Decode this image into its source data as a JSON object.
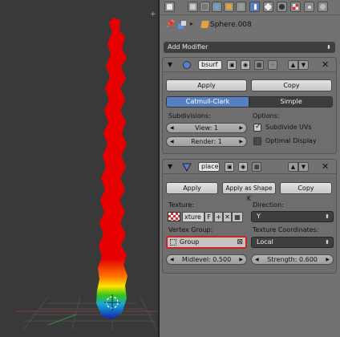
{
  "viewport": {
    "plus": "+"
  },
  "context_tabs": [
    {
      "icon": "render-icon"
    },
    {
      "icon": "render-layers-icon"
    },
    {
      "icon": "scene-icon"
    },
    {
      "icon": "world-icon"
    },
    {
      "icon": "object-icon"
    },
    {
      "icon": "constraints-icon"
    },
    {
      "icon": "modifiers-wrench-icon",
      "active": true
    },
    {
      "icon": "data-icon"
    },
    {
      "icon": "material-icon"
    },
    {
      "icon": "texture-icon"
    },
    {
      "icon": "particles-icon"
    },
    {
      "icon": "physics-icon"
    }
  ],
  "breadcrumb": {
    "object_name": "Sphere.008"
  },
  "add_modifier": "Add Modifier",
  "mod1": {
    "name": "bsurf",
    "apply": "Apply",
    "copy": "Copy",
    "seg_on": "Catmull-Clark",
    "seg_off": "Simple",
    "subdivisions_label": "Subdivisions:",
    "options_label": "Options:",
    "view": "View: 1",
    "render": "Render: 1",
    "subdivide_uvs": "Subdivide UVs",
    "optimal_display": "Optimal Display",
    "subdivide_uvs_checked": true,
    "optimal_display_checked": false
  },
  "mod2": {
    "name": "place",
    "apply": "Apply",
    "apply_shape": "Apply as Shape K",
    "copy": "Copy",
    "texture_label": "Texture:",
    "texture_value": "xture",
    "f_btn": "F",
    "direction_label": "Direction:",
    "direction_value": "Y",
    "vertex_group_label": "Vertex Group:",
    "vertex_group_value": "Group",
    "tex_coords_label": "Texture Coordinates:",
    "tex_coords_value": "Local",
    "midlevel": "Midlevel: 0.500",
    "strength": "Strength: 0.600"
  },
  "colors": {
    "accent": "#5680c2",
    "highlight": "#cc2222",
    "mesh": "#e60000"
  }
}
